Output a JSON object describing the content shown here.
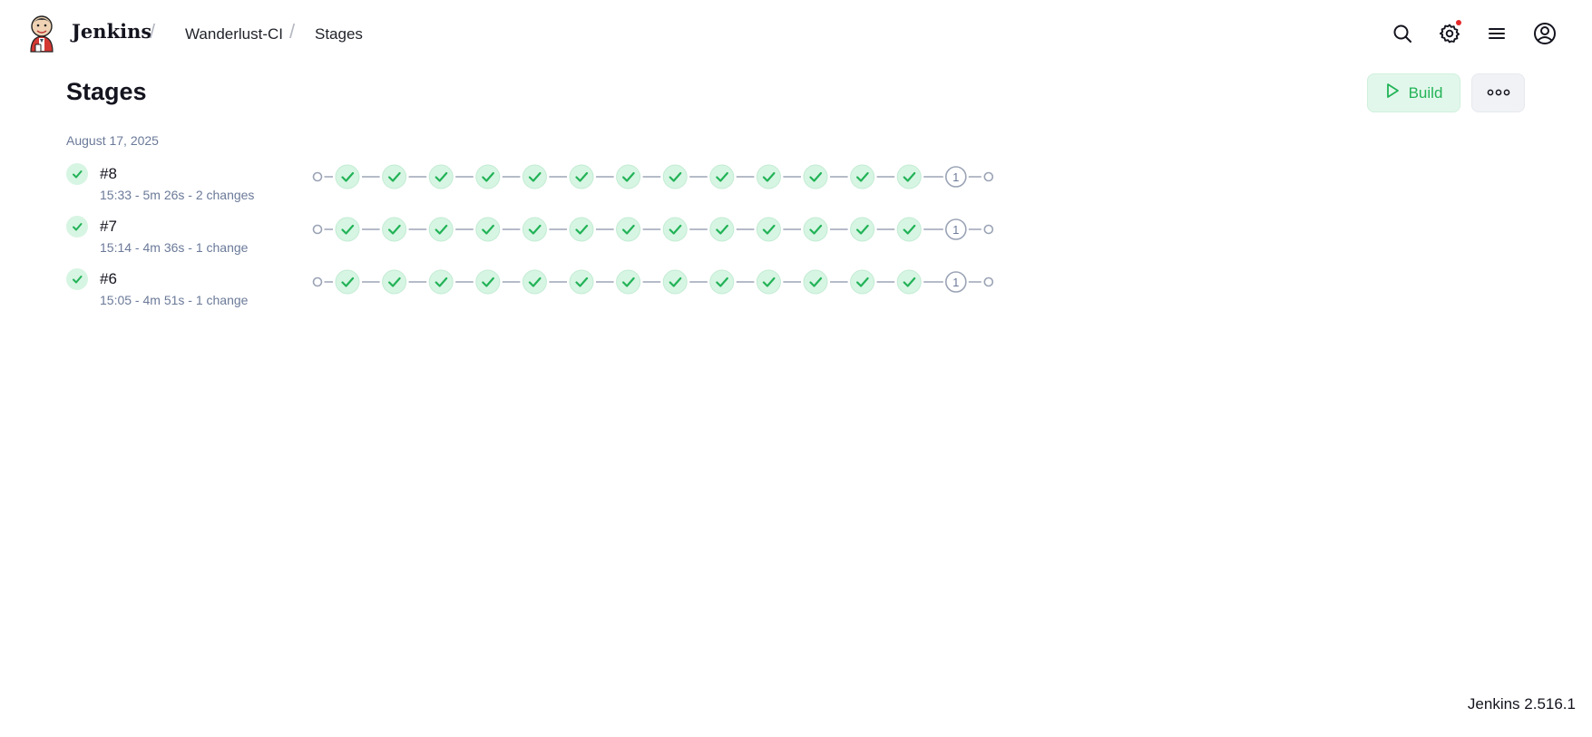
{
  "header": {
    "brand": "Jenkins",
    "breadcrumbs": [
      {
        "label": "Wanderlust-CI"
      },
      {
        "label": "Stages"
      }
    ],
    "icons": [
      "search-icon",
      "gear-icon",
      "menu-icon",
      "user-icon"
    ],
    "settings_has_notification": true
  },
  "page": {
    "title": "Stages",
    "build_button_label": "Build",
    "more_button_icon": "ellipsis-icon"
  },
  "builds": {
    "date": "August 17, 2025",
    "rows": [
      {
        "number": "#8",
        "meta": "15:33 - 5m 26s - 2 changes",
        "status": "success",
        "stages": [
          "success",
          "success",
          "success",
          "success",
          "success",
          "success",
          "success",
          "success",
          "success",
          "success",
          "success",
          "success",
          "success",
          "pending"
        ],
        "pending_label": "1"
      },
      {
        "number": "#7",
        "meta": "15:14 - 4m 36s - 1 change",
        "status": "success",
        "stages": [
          "success",
          "success",
          "success",
          "success",
          "success",
          "success",
          "success",
          "success",
          "success",
          "success",
          "success",
          "success",
          "success",
          "pending"
        ],
        "pending_label": "1"
      },
      {
        "number": "#6",
        "meta": "15:05 - 4m 51s - 1 change",
        "status": "success",
        "stages": [
          "success",
          "success",
          "success",
          "success",
          "success",
          "success",
          "success",
          "success",
          "success",
          "success",
          "success",
          "success",
          "success",
          "pending"
        ],
        "pending_label": "1"
      }
    ]
  },
  "colors": {
    "success": "#22b357",
    "success_bg": "#d7f5e3",
    "pending_stroke": "#9aa3b5",
    "connector": "#b5bbc8",
    "notification": "#e5292b"
  },
  "footer": {
    "version": "Jenkins 2.516.1"
  }
}
